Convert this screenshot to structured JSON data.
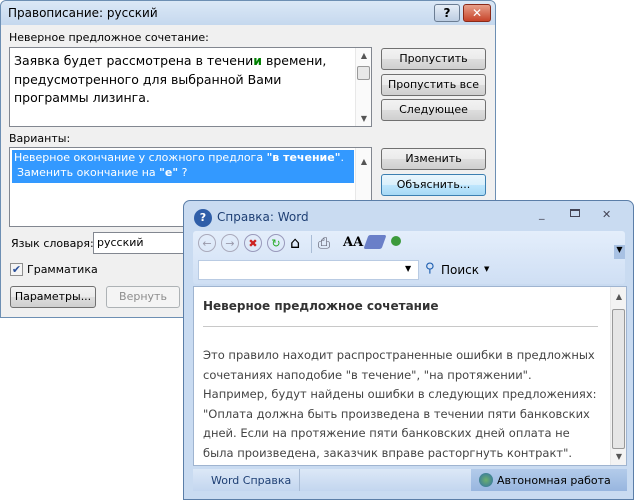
{
  "spelling_dialog": {
    "title": "Правописание: русский",
    "help_button": "?",
    "close_button": "✕",
    "error_label": "Неверное предложное сочетание:",
    "sentence_before": "Заявка будет рассмотрена в течени",
    "sentence_error": "и",
    "sentence_after": " времени, предусмотренного для выбранной Вами программы лизинга.",
    "suggestions_label": "Варианты:",
    "suggestion_line1_a": "Неверное окончание у сложного предлога ",
    "suggestion_line1_b": "\"в течение\"",
    "suggestion_line1_c": ".",
    "suggestion_line2_a": "Заменить окончание на ",
    "suggestion_line2_b": "\"е\"",
    "suggestion_line2_c": " ?",
    "buttons": {
      "skip": "Пропустить",
      "skip_all": "Пропустить все",
      "next": "Следующее",
      "change": "Изменить",
      "explain": "Объяснить...",
      "options": "Параметры...",
      "undo": "Вернуть"
    },
    "dictionary_label": "Язык словаря:",
    "dictionary_value": "русский",
    "grammar_label": "Грамматика",
    "grammar_checked": true,
    "highlight_color": "#3399ff",
    "error_color": "#008000"
  },
  "help_window": {
    "title": "Справка: Word",
    "toolbar_icons": [
      "back-icon",
      "forward-icon",
      "stop-icon",
      "refresh-icon",
      "home-icon",
      "print-icon",
      "font-size-icon",
      "book-icon",
      "pin-icon"
    ],
    "search_value": "",
    "search_label": "Поиск",
    "heading": "Неверное предложное сочетание",
    "body": "Это правило находит распространенные ошибки в предложных сочетаниях наподобие \"в течение\", \"на протяжении\". Например, будут найдены ошибки в следующих предложениях: \"Оплата должна быть произведена в течении пяти банковских дней. Если на протяжение пяти банковских дней оплата не была произведена, заказчик вправе расторгнуть контракт\".",
    "status_left": "Word Справка",
    "status_right": "Автономная работа"
  }
}
